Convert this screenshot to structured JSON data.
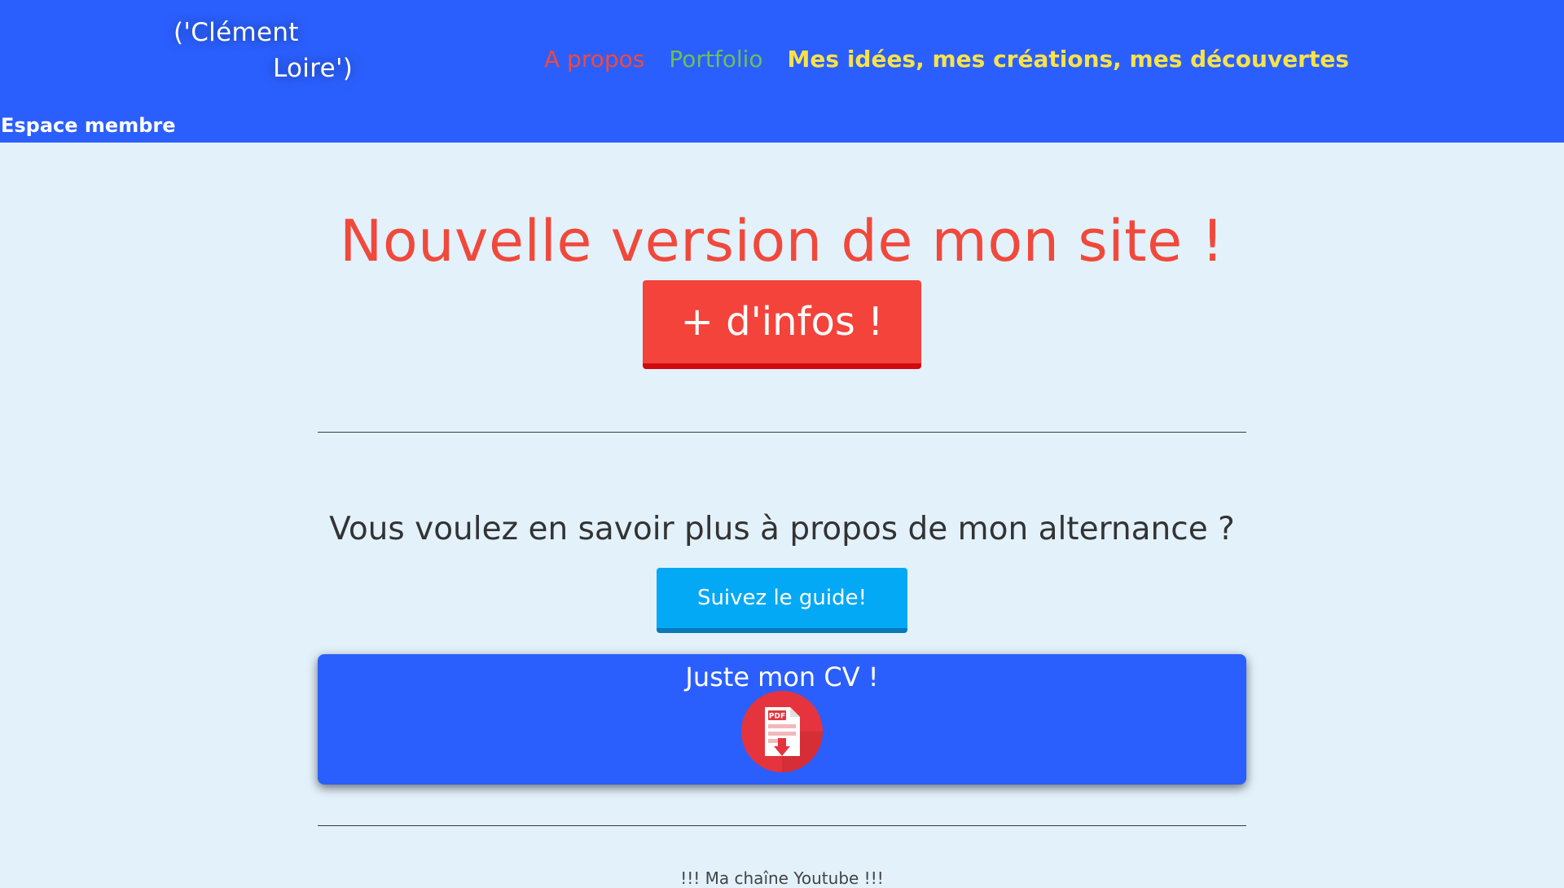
{
  "header": {
    "logo_line1": "('Clément",
    "logo_line2": "Loire')",
    "nav": [
      {
        "label": "A propos",
        "color": "#f0493c"
      },
      {
        "label": "Portfolio",
        "color": "#6bbf59"
      },
      {
        "label": "Mes idées, mes créations, mes découvertes",
        "color": "#f7e34a"
      }
    ],
    "background": "#2b5ffd"
  },
  "member_bar": {
    "link_label": "Espace membre"
  },
  "main": {
    "headline": "Nouvelle version de mon site !",
    "infos_button": "+ d'infos !",
    "question": "Vous voulez en savoir plus à propos de mon alternance ?",
    "guide_button": "Suivez le guide!",
    "cv_card": {
      "title": "Juste mon CV !",
      "icon": "pdf-download-icon",
      "icon_text": "PDF"
    },
    "youtube_text": "!!! Ma chaîne Youtube !!!"
  },
  "colors": {
    "accent_red": "#f3433a",
    "accent_blue": "#2b5ffd",
    "guide_blue": "#03a9f4",
    "page_background": "#e3f1fb"
  }
}
